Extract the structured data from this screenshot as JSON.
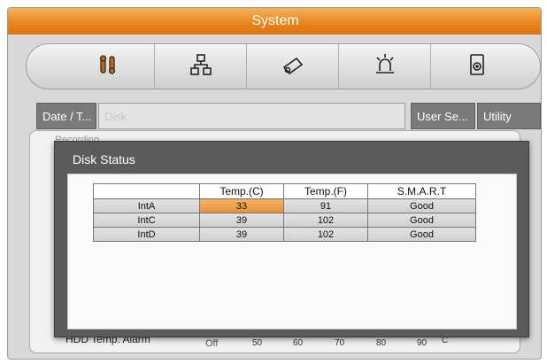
{
  "window": {
    "title": "System"
  },
  "toolbar": {
    "icons": [
      "system-tools-icon",
      "network-icon",
      "camera-icon",
      "alarm-icon",
      "disk-icon"
    ]
  },
  "tabs": [
    {
      "label": "Date / T..."
    },
    {
      "label": "Disk"
    },
    {
      "label": "User Se..."
    },
    {
      "label": "Utility"
    }
  ],
  "panel": {
    "recording_label": "Recording",
    "alarm_label": "HDD Temp. Alarm",
    "slider_ticks": [
      "Off",
      "50",
      "60",
      "70",
      "80",
      "90"
    ],
    "unit": "C"
  },
  "dialog": {
    "title": "Disk Status",
    "columns": [
      "",
      "Temp.(C)",
      "Temp.(F)",
      "S.M.A.R.T"
    ],
    "rows": [
      {
        "name": "IntA",
        "temp_c": "33",
        "temp_f": "91",
        "smart": "Good"
      },
      {
        "name": "IntC",
        "temp_c": "39",
        "temp_f": "102",
        "smart": "Good"
      },
      {
        "name": "IntD",
        "temp_c": "39",
        "temp_f": "102",
        "smart": "Good"
      }
    ]
  },
  "colors": {
    "accent": "#e8861f",
    "highlight": "#f0a04a",
    "dialog_bg": "#5b5b5b"
  }
}
